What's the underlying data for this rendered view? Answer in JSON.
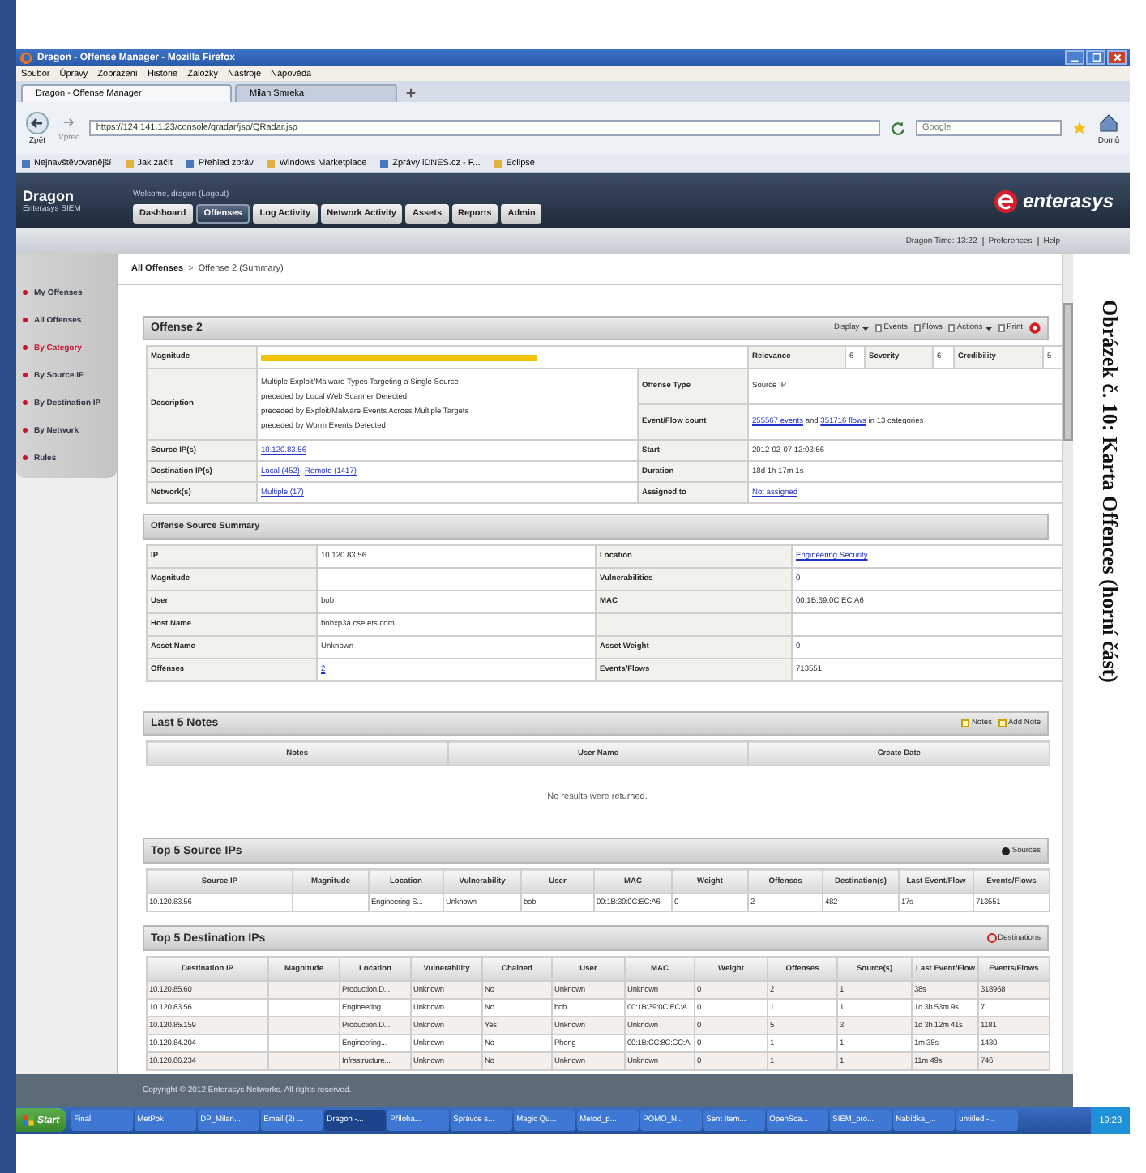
{
  "window": {
    "title": "Dragon - Offense Manager - Mozilla Firefox"
  },
  "menu": [
    "Soubor",
    "Úpravy",
    "Zobrazení",
    "Historie",
    "Záložky",
    "Nástroje",
    "Nápověda"
  ],
  "browser_tabs": [
    {
      "label": "Dragon - Offense Manager",
      "selected": true
    },
    {
      "label": "Milan Smreka",
      "selected": false
    }
  ],
  "nav": {
    "back": "Zpět",
    "forward": "Vpřed",
    "address": "https://124.141.1.23/console/qradar/jsp/QRadar.jsp",
    "search_placeholder": "Google",
    "home": "Domů"
  },
  "bookmarks": [
    "Nejnavštěvovanější",
    "Jak začít",
    "Přehled zpráv",
    "Windows Marketplace",
    "Zprávy iDNES.cz - F...",
    "Eclipse"
  ],
  "app": {
    "name": "Dragon",
    "subtitle": "Enterasys SIEM",
    "welcome": "Welcome, dragon (Logout)",
    "logo": "enterasys",
    "tabs": [
      {
        "label": "Dashboard",
        "selected": false
      },
      {
        "label": "Offenses",
        "selected": true
      },
      {
        "label": "Log Activity",
        "selected": false
      },
      {
        "label": "Network Activity",
        "selected": false
      },
      {
        "label": "Assets",
        "selected": false
      },
      {
        "label": "Reports",
        "selected": false
      },
      {
        "label": "Admin",
        "selected": false
      }
    ],
    "time_bar": [
      "Dragon Time: 13:22",
      "Preferences",
      "Help"
    ]
  },
  "sidebar": {
    "items": [
      {
        "label": "My Offenses",
        "selected": false
      },
      {
        "label": "All Offenses",
        "selected": false
      },
      {
        "label": "By Category",
        "selected": true
      },
      {
        "label": "By Source IP",
        "selected": false
      },
      {
        "label": "By Destination IP",
        "selected": false
      },
      {
        "label": "By Network",
        "selected": false
      },
      {
        "label": "Rules",
        "selected": false
      }
    ]
  },
  "breadcrumb": {
    "items": [
      "All Offenses",
      "Offense 2 (Summary)"
    ],
    "separator": ">"
  },
  "offense": {
    "title": "Offense 2",
    "toolbar": [
      {
        "label": "Display",
        "dropdown": true
      },
      {
        "label": "Events",
        "dropdown": false
      },
      {
        "label": "Flows",
        "dropdown": false
      },
      {
        "label": "Actions",
        "dropdown": true
      },
      {
        "label": "Print",
        "dropdown": false
      }
    ],
    "magnitude": {
      "label": "Magnitude",
      "level": 0.57
    },
    "scores": [
      {
        "label": "Relevance",
        "value": "6"
      },
      {
        "label": "Severity",
        "value": "6"
      },
      {
        "label": "Credibility",
        "value": "5"
      }
    ],
    "description": {
      "label": "Description",
      "lines": [
        "Multiple Exploit/Malware Types Targeting a Single Source",
        "preceded by Local Web Scanner Detected",
        "preceded by Exploit/Malware Events Across Multiple Targets",
        "preceded by Worm Events Detected"
      ]
    },
    "offense_type": {
      "label": "Offense Type",
      "value": "Source IP"
    },
    "event_flow_count": {
      "label": "Event/Flow count",
      "parts": [
        {
          "text": "255567 events",
          "link": true
        },
        {
          "text": " and ",
          "link": false
        },
        {
          "text": "351716 flows",
          "link": true
        },
        {
          "text": " in 13 categories",
          "link": false
        }
      ]
    },
    "detail_rows": [
      {
        "label": "Source IP(s)",
        "values": [
          {
            "text": "10.120.83.56",
            "link": true
          }
        ],
        "label_2": "Start",
        "values_2": [
          {
            "text": "2012-02-07 12:03:56",
            "link": false
          }
        ]
      },
      {
        "label": "Destination IP(s)",
        "values": [
          {
            "text": "Local (452)",
            "link": true
          },
          {
            "text": "Remote (1417)",
            "link": true
          }
        ],
        "label_2": "Duration",
        "values_2": [
          {
            "text": "18d 1h 17m 1s",
            "link": false
          }
        ]
      },
      {
        "label": "Network(s)",
        "values": [
          {
            "text": "Multiple (17)",
            "link": true
          }
        ],
        "label_2": "Assigned to",
        "values_2": [
          {
            "text": "Not assigned",
            "link": true
          }
        ]
      }
    ]
  },
  "source_summary": {
    "title": "Offense Source Summary",
    "rows": [
      {
        "label": "IP",
        "value": {
          "text": "10.120.83.56",
          "link": false
        },
        "label_2": "Location",
        "value_2": {
          "text": "Engineering Security",
          "link": true
        }
      },
      {
        "label": "Magnitude",
        "label_2": "Vulnerabilities",
        "value_2": {
          "text": "0",
          "link": false
        }
      },
      {
        "label": "User",
        "value": {
          "text": "bob",
          "link": false
        },
        "label_2": "MAC",
        "value_2": {
          "text": "00:1B:39:0C:EC:A6",
          "link": false
        }
      },
      {
        "label": "Host Name",
        "value": {
          "text": "bobxp3a.cse.ets.com",
          "link": false
        }
      },
      {
        "label": "Asset Name",
        "value": {
          "text": "Unknown",
          "link": false
        },
        "label_2": "Asset Weight",
        "value_2": {
          "text": "0",
          "link": false
        }
      },
      {
        "label": "Offenses",
        "value": {
          "text": "2",
          "link": true
        },
        "label_2": "Events/Flows",
        "value_2": {
          "text": "713551",
          "link": false
        }
      }
    ]
  },
  "notes": {
    "title": "Last 5 Notes",
    "actions": [
      "Notes",
      "Add Note"
    ],
    "columns": [
      "Notes",
      "User Name",
      "Create Date"
    ],
    "empty_message": "No results were returned."
  },
  "top_sources": {
    "title": "Top 5 Source IPs",
    "action": "Sources",
    "columns": [
      "Source IP",
      "Magnitude",
      "Location",
      "Vulnerability",
      "User",
      "MAC",
      "Weight",
      "Offenses",
      "Destination(s)",
      "Last Event/Flow",
      "Events/Flows"
    ],
    "rows": [
      [
        "10.120.83.56",
        null,
        "Engineering S...",
        "Unknown",
        "bob",
        "00:1B:39:0C:EC:A6",
        "0",
        "2",
        "482",
        "17s",
        "713551"
      ]
    ]
  },
  "top_destinations": {
    "title": "Top 5 Destination IPs",
    "action": "Destinations",
    "columns": [
      "Destination IP",
      "Magnitude",
      "Location",
      "Vulnerability",
      "Chained",
      "User",
      "MAC",
      "Weight",
      "Offenses",
      "Source(s)",
      "Last Event/Flow",
      "Events/Flows"
    ],
    "rows": [
      [
        "10.120.85.60",
        null,
        "Production.D...",
        "Unknown",
        "No",
        "Unknown",
        "Unknown",
        "0",
        "2",
        "1",
        "38s",
        "318968"
      ],
      [
        "10.120.83.56",
        null,
        "Engineering...",
        "Unknown",
        "No",
        "bob",
        "00:1B:39:0C:EC:A",
        "0",
        "1",
        "1",
        "1d 3h 53m 9s",
        "7"
      ],
      [
        "10.120.85.159",
        null,
        "Production.D...",
        "Unknown",
        "Yes",
        "Unknown",
        "Unknown",
        "0",
        "5",
        "3",
        "1d 3h 12m 41s",
        "1181"
      ],
      [
        "10.120.84.204",
        null,
        "Engineering...",
        "Unknown",
        "No",
        "Phong",
        "00:1B:CC:8C:CC:A",
        "0",
        "1",
        "1",
        "1m 38s",
        "1430"
      ],
      [
        "10.120.86.234",
        null,
        "Infrastructure...",
        "Unknown",
        "No",
        "Unknown",
        "Unknown",
        "0",
        "1",
        "1",
        "11m 49s",
        "746"
      ]
    ]
  },
  "footer": "Copyright © 2012 Enterasys Networks. All rights reserved.",
  "taskbar": {
    "start": "Start",
    "items": [
      {
        "label": "Final",
        "selected": false
      },
      {
        "label": "MetPok",
        "selected": false
      },
      {
        "label": "DP_Milan...",
        "selected": false
      },
      {
        "label": "Email (2) ...",
        "selected": false
      },
      {
        "label": "Dragon -...",
        "selected": true
      },
      {
        "label": "Příloha...",
        "selected": false
      },
      {
        "label": "Správce s...",
        "selected": false
      },
      {
        "label": "Magic Qu...",
        "selected": false
      },
      {
        "label": "Metod_p...",
        "selected": false
      },
      {
        "label": "POMO_N...",
        "selected": false
      },
      {
        "label": "Sent Item...",
        "selected": false
      },
      {
        "label": "OpenSca...",
        "selected": false
      },
      {
        "label": "SIEM_pro...",
        "selected": false
      },
      {
        "label": "Nabídka_...",
        "selected": false
      },
      {
        "label": "untitled -...",
        "selected": false
      }
    ],
    "clock": "19:23"
  },
  "caption": "Obrázek č. 10: Karta Offences (horní část)"
}
